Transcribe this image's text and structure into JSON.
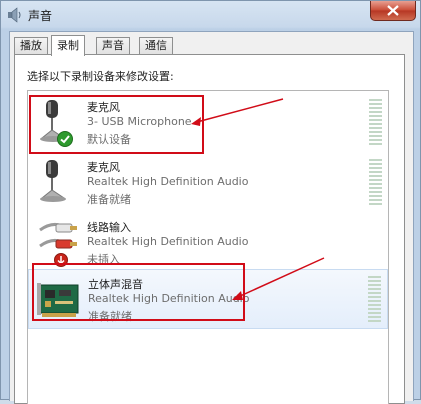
{
  "window": {
    "title": "声音",
    "icon": "speaker-icon"
  },
  "tabs": [
    {
      "label": "播放",
      "active": false
    },
    {
      "label": "录制",
      "active": true
    },
    {
      "label": "声音",
      "active": false
    },
    {
      "label": "通信",
      "active": false
    }
  ],
  "prompt": "选择以下录制设备来修改设置:",
  "devices": [
    {
      "name": "麦克风",
      "description": "3- USB Microphone",
      "status": "默认设备",
      "icon": "microphone-icon",
      "badge": "default-check-icon",
      "highlighted": false
    },
    {
      "name": "麦克风",
      "description": "Realtek High Definition Audio",
      "status": "准备就绪",
      "icon": "microphone-icon",
      "highlighted": false
    },
    {
      "name": "线路输入",
      "description": "Realtek High Definition Audio",
      "status": "未插入",
      "icon": "line-in-jack-icon",
      "badge": "unplugged-icon",
      "highlighted": false
    },
    {
      "name": "立体声混音",
      "description": "Realtek High Definition Audio",
      "status": "准备就绪",
      "icon": "sound-card-icon",
      "highlighted": true
    }
  ],
  "colors": {
    "annotation_red": "#d10c18",
    "level_meter": "#c3d7c6",
    "default_check": "#2e9a2e"
  }
}
